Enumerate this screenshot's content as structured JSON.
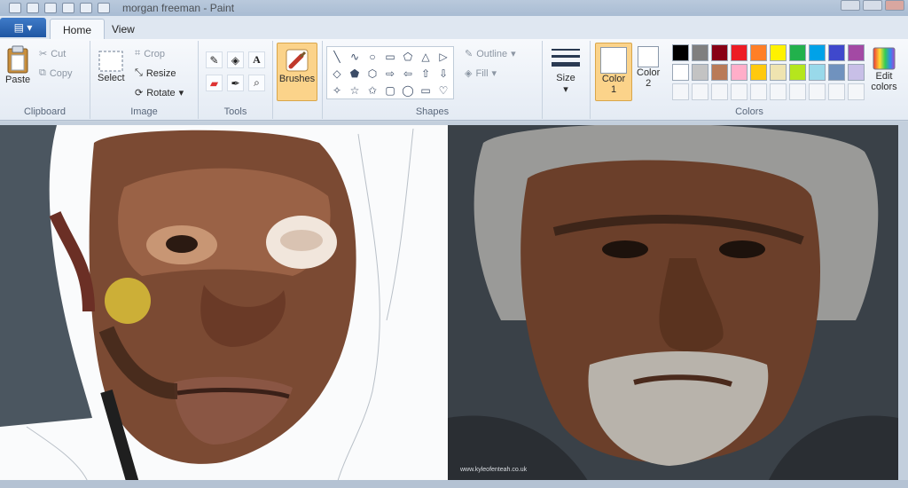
{
  "window": {
    "title": "morgan freeman - Paint"
  },
  "tabs": {
    "file": "▤ ▾",
    "home": "Home",
    "view": "View"
  },
  "clipboard": {
    "paste": "Paste",
    "cut": "Cut",
    "copy": "Copy",
    "group": "Clipboard"
  },
  "image": {
    "select": "Select",
    "crop": "Crop",
    "resize": "Resize",
    "rotate": "Rotate",
    "group": "Image"
  },
  "tools": {
    "group": "Tools"
  },
  "brushes": {
    "label": "Brushes"
  },
  "shapes": {
    "outline": "Outline",
    "fill": "Fill",
    "group": "Shapes",
    "icons": [
      "╲",
      "∿",
      "○",
      "▭",
      "⬠",
      "△",
      "▷",
      "◇",
      "⬟",
      "⬡",
      "⇨",
      "⇦",
      "⇧",
      "⇩",
      "✧",
      "☆",
      "✩",
      "▢",
      "◯",
      "▭",
      "♡",
      "⚡",
      "⬜",
      "⬚"
    ]
  },
  "size": {
    "label": "Size"
  },
  "colors": {
    "color1": "Color",
    "color1_num": "1",
    "color2": "Color",
    "color2_num": "2",
    "group": "Colors",
    "edit1": "Edit",
    "edit2": "colors",
    "palette_row1": [
      "#000000",
      "#7f7f7f",
      "#880015",
      "#ed1c24",
      "#ff7f27",
      "#fff200",
      "#22b14c",
      "#00a2e8",
      "#3f48cc",
      "#a349a4"
    ],
    "palette_row2": [
      "#ffffff",
      "#c3c3c3",
      "#b97a57",
      "#ffaec9",
      "#ffc90e",
      "#efe4b0",
      "#b5e61d",
      "#99d9ea",
      "#7092be",
      "#c8bfe7"
    ]
  },
  "photo": {
    "watermark": "www.kyleofenteah.co.uk"
  }
}
